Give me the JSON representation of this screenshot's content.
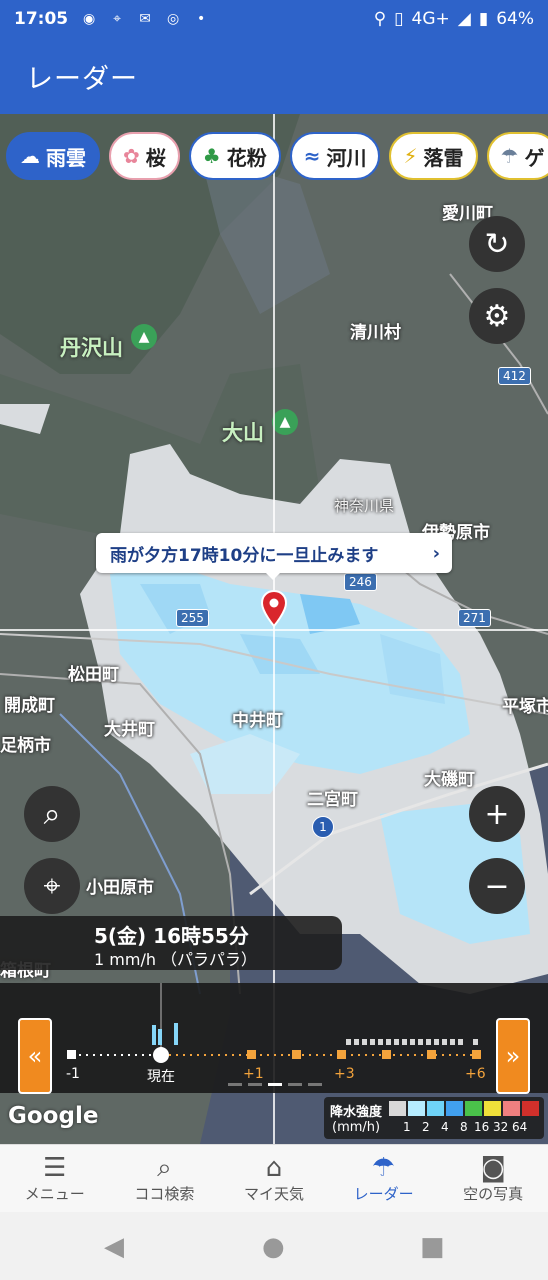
{
  "status_bar": {
    "time": "17:05",
    "icons": [
      "notification-icon",
      "tracking-icon",
      "mail-icon",
      "chrome-icon",
      "dot-icon"
    ],
    "right_icons": [
      "location-icon",
      "vibrate-icon"
    ],
    "network": "4G+",
    "battery": "64%"
  },
  "app_bar": {
    "title": "レーダー"
  },
  "chips": [
    {
      "label": "雨雲",
      "icon": "rain-cloud-icon",
      "active": true
    },
    {
      "label": "桜",
      "icon": "sakura-icon"
    },
    {
      "label": "花粉",
      "icon": "tree-icon"
    },
    {
      "label": "河川",
      "icon": "river-icon"
    },
    {
      "label": "落雷",
      "icon": "lightning-icon"
    },
    {
      "label": "ゲ",
      "icon": "storm-icon"
    }
  ],
  "map": {
    "places": [
      {
        "name": "愛川町"
      },
      {
        "name": "丹沢山"
      },
      {
        "name": "清川村"
      },
      {
        "name": "大山"
      },
      {
        "name": "神奈川県"
      },
      {
        "name": "伊勢原市"
      },
      {
        "name": "松田町"
      },
      {
        "name": "開成町"
      },
      {
        "name": "大井町"
      },
      {
        "name": "中井町"
      },
      {
        "name": "平塚市"
      },
      {
        "name": "足柄市"
      },
      {
        "name": "大磯町"
      },
      {
        "name": "二宮町"
      },
      {
        "name": "小田原市"
      },
      {
        "name": "箱根町"
      }
    ],
    "routes": [
      "412",
      "246",
      "255",
      "271",
      "1"
    ],
    "google_label": "Google"
  },
  "bubble": {
    "text": "雨が夕方17時10分に一旦止みます",
    "chevron": "›"
  },
  "time_panel": {
    "time": "5(金) 16時55分",
    "intensity": "1 mm/h （パラパラ）"
  },
  "timeline": {
    "labels": {
      "minus1": "-1",
      "now": "現在",
      "plus1": "+1",
      "plus3": "+3",
      "plus6": "+6"
    }
  },
  "legend": {
    "title": "降水強度",
    "unit": "(mm/h)",
    "values": [
      "1",
      "2",
      "4",
      "8",
      "16",
      "32",
      "64"
    ],
    "colors": [
      "#d8d8d8",
      "#b6ecff",
      "#6fd3f8",
      "#41a0ef",
      "#4ac24a",
      "#f0e03a",
      "#f08080",
      "#d0302b"
    ]
  },
  "bottom_nav": [
    {
      "label": "メニュー",
      "icon": "menu-icon"
    },
    {
      "label": "ココ検索",
      "icon": "search-icon"
    },
    {
      "label": "マイ天気",
      "icon": "home-icon"
    },
    {
      "label": "レーダー",
      "icon": "umbrella-icon",
      "active": true
    },
    {
      "label": "空の写真",
      "icon": "camera-icon"
    }
  ]
}
